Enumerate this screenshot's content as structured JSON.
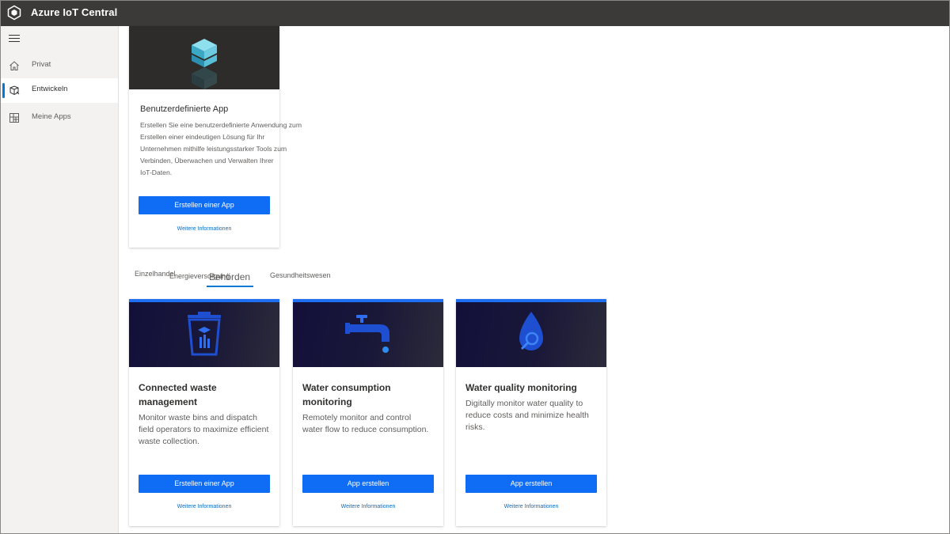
{
  "app": {
    "title": "Azure IoT Central"
  },
  "sidebar": {
    "menu_icon": "hamburger-icon",
    "items": [
      {
        "label": "Privat",
        "icon": "home-icon",
        "active": false
      },
      {
        "label": "Entwickeln",
        "icon": "build-icon",
        "active": true
      },
      {
        "label": "Meine Apps",
        "icon": "apps-grid-icon",
        "active": false
      }
    ]
  },
  "custom_app": {
    "title": "Benutzerdefinierte App",
    "description_lines": [
      "Erstellen Sie eine benutzerdefinierte Anwendung zum",
      "Erstellen einer eindeutigen Lösung für Ihr",
      "Unternehmen mithilfe leistungsstarker Tools zum",
      "Verbinden, Überwachen und Verwalten Ihrer",
      "IoT-Daten."
    ],
    "button_label": "Erstellen einer App",
    "link_label": "Weitere Informationen",
    "icon": "cube-stack-icon"
  },
  "tabs": [
    {
      "label": "Einzelhandel",
      "active": false
    },
    {
      "label": "Energieversorgung",
      "active": false
    },
    {
      "label": "Behörden",
      "active": true
    },
    {
      "label": "Gesundheitswesen",
      "active": false
    }
  ],
  "templates": [
    {
      "title_lines": [
        "Connected waste",
        "management"
      ],
      "description_lines": [
        "Monitor waste bins and dispatch",
        "field operators to maximize efficient",
        "waste collection."
      ],
      "button_label": "Erstellen einer App",
      "link_label": "Weitere Informationen",
      "icon": "waste-bin-icon"
    },
    {
      "title_lines": [
        "Water consumption",
        "monitoring"
      ],
      "description_lines": [
        "Remotely monitor and control",
        "water flow to reduce consumption."
      ],
      "button_label": "App erstellen",
      "link_label": "Weitere Informationen",
      "icon": "water-tap-icon"
    },
    {
      "title_lines": [
        "Water quality monitoring"
      ],
      "description_lines": [
        "Digitally monitor water quality to",
        "reduce costs and minimize health",
        "risks."
      ],
      "button_label": "App erstellen",
      "link_label": "Weitere Informationen",
      "icon": "water-drop-search-icon"
    }
  ],
  "colors": {
    "accent": "#0078d4",
    "button": "#0f6cf5",
    "topbar": "#3b3a39",
    "hero_dark": "#12103a"
  }
}
